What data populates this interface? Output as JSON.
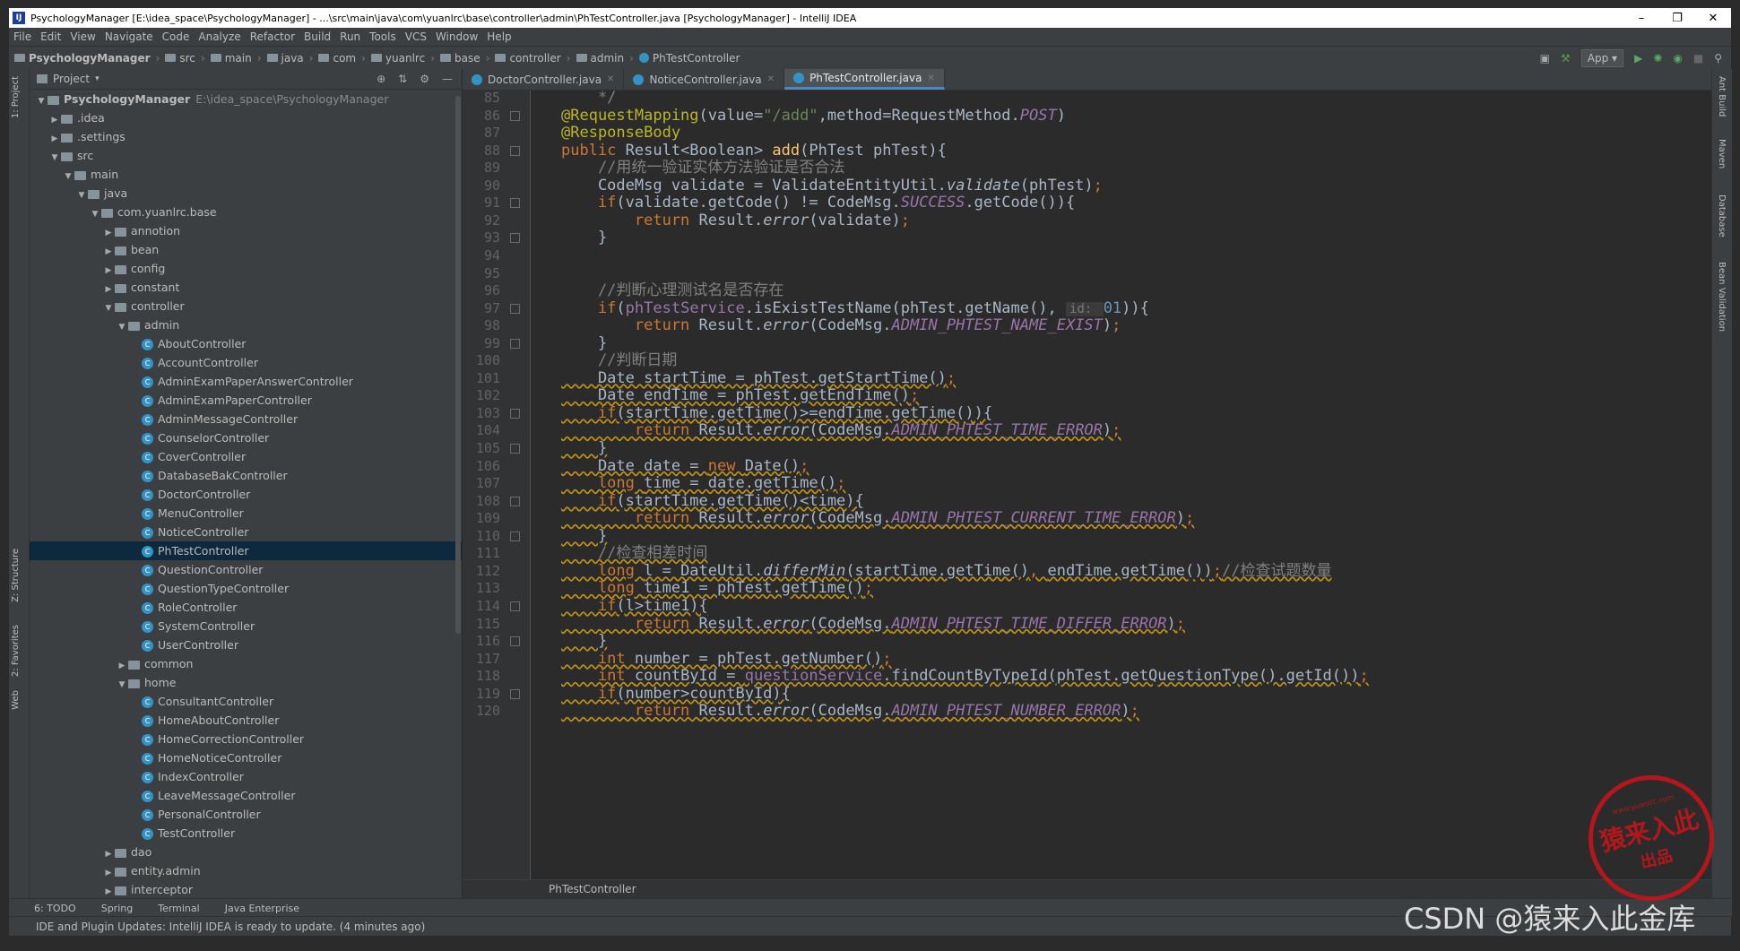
{
  "window": {
    "title": "PsychologyManager [E:\\idea_space\\PsychologyManager] - ...\\src\\main\\java\\com\\yuanlrc\\base\\controller\\admin\\PhTestController.java [PsychologyManager] - IntelliJ IDEA",
    "minimize": "–",
    "maximize": "❐",
    "close": "✕"
  },
  "menu": [
    "File",
    "Edit",
    "View",
    "Navigate",
    "Code",
    "Analyze",
    "Refactor",
    "Build",
    "Run",
    "Tools",
    "VCS",
    "Window",
    "Help"
  ],
  "breadcrumbs": [
    "PsychologyManager",
    "src",
    "main",
    "java",
    "com",
    "yuanlrc",
    "base",
    "controller",
    "admin",
    "PhTestController"
  ],
  "run_config": "App",
  "left_tool_tabs": [
    "1: Project",
    "Z: Structure",
    "2: Favorites",
    "Web"
  ],
  "right_tool_tabs": [
    "Ant Build",
    "Maven",
    "Database",
    "Bean Validation"
  ],
  "project_panel": {
    "title": "Project",
    "tree": [
      {
        "depth": 0,
        "type": "folder",
        "open": true,
        "label": "PsychologyManager",
        "path": "E:\\idea_space\\PsychologyManager"
      },
      {
        "depth": 1,
        "type": "folder",
        "open": false,
        "label": ".idea"
      },
      {
        "depth": 1,
        "type": "folder",
        "open": false,
        "label": ".settings"
      },
      {
        "depth": 1,
        "type": "folder",
        "open": true,
        "label": "src"
      },
      {
        "depth": 2,
        "type": "folder",
        "open": true,
        "label": "main"
      },
      {
        "depth": 3,
        "type": "folder",
        "open": true,
        "label": "java"
      },
      {
        "depth": 4,
        "type": "folder",
        "open": true,
        "label": "com.yuanlrc.base"
      },
      {
        "depth": 5,
        "type": "folder",
        "open": false,
        "label": "annotion"
      },
      {
        "depth": 5,
        "type": "folder",
        "open": false,
        "label": "bean"
      },
      {
        "depth": 5,
        "type": "folder",
        "open": false,
        "label": "config"
      },
      {
        "depth": 5,
        "type": "folder",
        "open": false,
        "label": "constant"
      },
      {
        "depth": 5,
        "type": "folder",
        "open": true,
        "label": "controller"
      },
      {
        "depth": 6,
        "type": "folder",
        "open": true,
        "label": "admin"
      },
      {
        "depth": 7,
        "type": "class",
        "label": "AboutController"
      },
      {
        "depth": 7,
        "type": "class",
        "label": "AccountController"
      },
      {
        "depth": 7,
        "type": "class",
        "label": "AdminExamPaperAnswerController"
      },
      {
        "depth": 7,
        "type": "class",
        "label": "AdminExamPaperController"
      },
      {
        "depth": 7,
        "type": "class",
        "label": "AdminMessageController"
      },
      {
        "depth": 7,
        "type": "class",
        "label": "CounselorController"
      },
      {
        "depth": 7,
        "type": "class",
        "label": "CoverController"
      },
      {
        "depth": 7,
        "type": "class",
        "label": "DatabaseBakController"
      },
      {
        "depth": 7,
        "type": "class",
        "label": "DoctorController"
      },
      {
        "depth": 7,
        "type": "class",
        "label": "MenuController"
      },
      {
        "depth": 7,
        "type": "class",
        "label": "NoticeController"
      },
      {
        "depth": 7,
        "type": "class",
        "label": "PhTestController",
        "selected": true
      },
      {
        "depth": 7,
        "type": "class",
        "label": "QuestionController"
      },
      {
        "depth": 7,
        "type": "class",
        "label": "QuestionTypeController"
      },
      {
        "depth": 7,
        "type": "class",
        "label": "RoleController"
      },
      {
        "depth": 7,
        "type": "class",
        "label": "SystemController"
      },
      {
        "depth": 7,
        "type": "class",
        "label": "UserController"
      },
      {
        "depth": 6,
        "type": "folder",
        "open": false,
        "label": "common"
      },
      {
        "depth": 6,
        "type": "folder",
        "open": true,
        "label": "home"
      },
      {
        "depth": 7,
        "type": "class",
        "label": "ConsultantController"
      },
      {
        "depth": 7,
        "type": "class",
        "label": "HomeAboutController"
      },
      {
        "depth": 7,
        "type": "class",
        "label": "HomeCorrectionController"
      },
      {
        "depth": 7,
        "type": "class",
        "label": "HomeNoticeController"
      },
      {
        "depth": 7,
        "type": "class",
        "label": "IndexController"
      },
      {
        "depth": 7,
        "type": "class",
        "label": "LeaveMessageController"
      },
      {
        "depth": 7,
        "type": "class",
        "label": "PersonalController"
      },
      {
        "depth": 7,
        "type": "class",
        "label": "TestController"
      },
      {
        "depth": 5,
        "type": "folder",
        "open": false,
        "label": "dao"
      },
      {
        "depth": 5,
        "type": "folder",
        "open": false,
        "label": "entity.admin"
      },
      {
        "depth": 5,
        "type": "folder",
        "open": false,
        "label": "interceptor"
      }
    ]
  },
  "editor_tabs": [
    {
      "label": "DoctorController.java",
      "active": false
    },
    {
      "label": "NoticeController.java",
      "active": false
    },
    {
      "label": "PhTestController.java",
      "active": true
    }
  ],
  "code_lines": [
    {
      "n": 85,
      "segs": [
        [
          "cmt",
          "    */"
        ]
      ]
    },
    {
      "n": 86,
      "segs": [
        [
          "ann",
          "@RequestMapping"
        ],
        [
          "",
          "(value="
        ],
        [
          "str",
          "\"/add\""
        ],
        [
          "",
          ",method=RequestMethod."
        ],
        [
          "st",
          "POST"
        ],
        [
          "",
          ")"
        ]
      ]
    },
    {
      "n": 87,
      "segs": [
        [
          "ann",
          "@ResponseBody"
        ]
      ]
    },
    {
      "n": 88,
      "segs": [
        [
          "kw",
          "public "
        ],
        [
          "",
          "Result<Boolean> "
        ],
        [
          "fn",
          "add"
        ],
        [
          "",
          "(PhTest phTest){"
        ]
      ]
    },
    {
      "n": 89,
      "segs": [
        [
          "cmt",
          "    //用统一验证实体方法验证是否合法"
        ]
      ]
    },
    {
      "n": 90,
      "segs": [
        [
          "",
          "    CodeMsg validate = ValidateEntityUtil."
        ],
        [
          "it",
          "validate"
        ],
        [
          "",
          "(phTest)"
        ],
        [
          "kw",
          ";"
        ]
      ]
    },
    {
      "n": 91,
      "segs": [
        [
          "kw",
          "    if"
        ],
        [
          "",
          "(validate.getCode() != CodeMsg."
        ],
        [
          "st",
          "SUCCESS"
        ],
        [
          "",
          ".getCode()){"
        ]
      ]
    },
    {
      "n": 92,
      "segs": [
        [
          "kw",
          "        return "
        ],
        [
          "",
          "Result."
        ],
        [
          "it",
          "error"
        ],
        [
          "",
          "(validate)"
        ],
        [
          "kw",
          ";"
        ]
      ]
    },
    {
      "n": 93,
      "segs": [
        [
          "",
          "    }"
        ]
      ]
    },
    {
      "n": 94,
      "segs": []
    },
    {
      "n": 95,
      "segs": []
    },
    {
      "n": 96,
      "segs": [
        [
          "cmt",
          "    //判断心理测试名是否存在"
        ]
      ]
    },
    {
      "n": 97,
      "segs": [
        [
          "kw",
          "    if"
        ],
        [
          "",
          "("
        ],
        [
          "fld",
          "phTestService"
        ],
        [
          "",
          ".isExistTestName(phTest.getName(), "
        ],
        [
          "hint",
          "id: "
        ],
        [
          "num",
          "01"
        ],
        [
          "",
          ")){"
        ]
      ]
    },
    {
      "n": 98,
      "segs": [
        [
          "kw",
          "        return "
        ],
        [
          "",
          "Result."
        ],
        [
          "it",
          "error"
        ],
        [
          "",
          "(CodeMsg."
        ],
        [
          "st",
          "ADMIN_PHTEST_NAME_EXIST"
        ],
        [
          "",
          ")"
        ],
        [
          "kw",
          ";"
        ]
      ]
    },
    {
      "n": 99,
      "segs": [
        [
          "",
          "    }"
        ]
      ]
    },
    {
      "n": 100,
      "segs": [
        [
          "cmt",
          "    //判断日期"
        ]
      ]
    },
    {
      "n": 101,
      "segs": [
        [
          "",
          "    Date startTime = phTest.getStartTime()"
        ],
        [
          "kw",
          ";"
        ]
      ],
      "warn": true
    },
    {
      "n": 102,
      "segs": [
        [
          "",
          "    Date endTime = phTest.getEndTime()"
        ],
        [
          "kw",
          ";"
        ]
      ],
      "warn": true
    },
    {
      "n": 103,
      "segs": [
        [
          "kw",
          "    if"
        ],
        [
          "",
          "(startTime.getTime()>=endTime.getTime()){"
        ]
      ],
      "warn": true
    },
    {
      "n": 104,
      "segs": [
        [
          "kw",
          "        return "
        ],
        [
          "",
          "Result."
        ],
        [
          "it",
          "error"
        ],
        [
          "",
          "(CodeMsg."
        ],
        [
          "st",
          "ADMIN_PHTEST_TIME_ERROR"
        ],
        [
          "",
          ")"
        ],
        [
          "kw",
          ";"
        ]
      ],
      "warn": true
    },
    {
      "n": 105,
      "segs": [
        [
          "",
          "    }"
        ]
      ],
      "warn": true
    },
    {
      "n": 106,
      "segs": [
        [
          "",
          "    Date date = "
        ],
        [
          "kw",
          "new "
        ],
        [
          "",
          "Date()"
        ],
        [
          "kw",
          ";"
        ]
      ],
      "warn": true
    },
    {
      "n": 107,
      "segs": [
        [
          "kw",
          "    long "
        ],
        [
          "",
          "time = date.getTime()"
        ],
        [
          "kw",
          ";"
        ]
      ],
      "warn": true
    },
    {
      "n": 108,
      "segs": [
        [
          "kw",
          "    if"
        ],
        [
          "",
          "(startTime.getTime()<time){"
        ]
      ],
      "warn": true
    },
    {
      "n": 109,
      "segs": [
        [
          "kw",
          "        return "
        ],
        [
          "",
          "Result."
        ],
        [
          "it",
          "error"
        ],
        [
          "",
          "(CodeMsg."
        ],
        [
          "st",
          "ADMIN_PHTEST_CURRENT_TIME_ERROR"
        ],
        [
          "",
          ")"
        ],
        [
          "kw",
          ";"
        ]
      ],
      "warn": true
    },
    {
      "n": 110,
      "segs": [
        [
          "",
          "    }"
        ]
      ],
      "warn": true
    },
    {
      "n": 111,
      "segs": [
        [
          "cmt",
          "    //检查相差时间"
        ]
      ],
      "warn": true
    },
    {
      "n": 112,
      "segs": [
        [
          "kw",
          "    long "
        ],
        [
          "",
          "l = DateUtil."
        ],
        [
          "it",
          "differMin"
        ],
        [
          "",
          "(startTime.getTime()"
        ],
        [
          "kw",
          ", "
        ],
        [
          "",
          "endTime.getTime())"
        ],
        [
          "kw",
          ";"
        ],
        [
          "cmt",
          "//检查试题数量"
        ]
      ],
      "warn": true
    },
    {
      "n": 113,
      "segs": [
        [
          "kw",
          "    long "
        ],
        [
          "",
          "time1 = phTest.getTime()"
        ],
        [
          "kw",
          ";"
        ]
      ],
      "warn": true
    },
    {
      "n": 114,
      "segs": [
        [
          "kw",
          "    if"
        ],
        [
          "",
          "(l>time1){"
        ]
      ],
      "warn": true
    },
    {
      "n": 115,
      "segs": [
        [
          "kw",
          "        return "
        ],
        [
          "",
          "Result."
        ],
        [
          "it",
          "error"
        ],
        [
          "",
          "(CodeMsg."
        ],
        [
          "st",
          "ADMIN_PHTEST_TIME_DIFFER_ERROR"
        ],
        [
          "",
          ")"
        ],
        [
          "kw",
          ";"
        ]
      ],
      "warn": true
    },
    {
      "n": 116,
      "segs": [
        [
          "",
          "    }"
        ]
      ],
      "warn": true
    },
    {
      "n": 117,
      "segs": [
        [
          "kw",
          "    int "
        ],
        [
          "",
          "number = phTest.getNumber()"
        ],
        [
          "kw",
          ";"
        ]
      ],
      "warn": true
    },
    {
      "n": 118,
      "segs": [
        [
          "kw",
          "    int "
        ],
        [
          "",
          "countById = "
        ],
        [
          "fld",
          "questionService"
        ],
        [
          "",
          ".findCountByTypeId(phTest.getQuestionType().getId())"
        ],
        [
          "kw",
          ";"
        ]
      ],
      "warn": true
    },
    {
      "n": 119,
      "segs": [
        [
          "kw",
          "    if"
        ],
        [
          "",
          "(number>countById){"
        ]
      ],
      "warn": true
    },
    {
      "n": 120,
      "segs": [
        [
          "kw",
          "        return "
        ],
        [
          "",
          "Result."
        ],
        [
          "it",
          "error"
        ],
        [
          "",
          "(CodeMsg."
        ],
        [
          "st",
          "ADMIN_PHTEST_NUMBER_ERROR"
        ],
        [
          "",
          ")"
        ],
        [
          "kw",
          ";"
        ]
      ],
      "warn": true
    }
  ],
  "editor_breadcrumb": "PhTestController",
  "bottom_tools": [
    "6: TODO",
    "Spring",
    "Terminal",
    "Java Enterprise"
  ],
  "status": "IDE and Plugin Updates: IntelliJ IDEA is ready to update. (4 minutes ago)",
  "watermark": "CSDN @猿来入此金库",
  "stamp": {
    "top": "www.yuanlrc.com",
    "main": "猿来入此",
    "sub": "出品"
  },
  "colors": {
    "keyword": "#cc7832",
    "annotation": "#bbb529",
    "string": "#6a8759",
    "comment": "#808080",
    "static": "#9876aa",
    "method": "#ffc66d",
    "selection": "#0d293e",
    "stamp": "#c0161a"
  }
}
